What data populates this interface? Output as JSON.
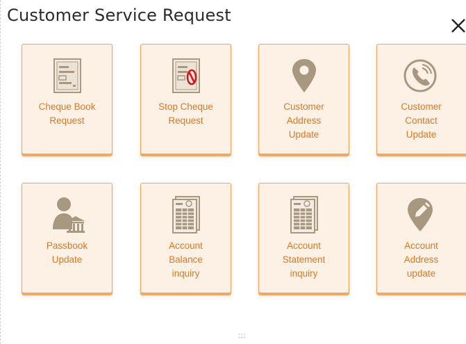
{
  "dialog": {
    "title": "Customer Service Request"
  },
  "tiles": [
    {
      "label1": "Cheque Book",
      "label2": "Request",
      "label3": "",
      "icon": "cheque-book-icon"
    },
    {
      "label1": "Stop Cheque",
      "label2": "Request",
      "label3": "",
      "icon": "stop-cheque-icon"
    },
    {
      "label1": "Customer",
      "label2": "Address",
      "label3": "Update",
      "icon": "location-pin-icon"
    },
    {
      "label1": "Customer",
      "label2": "Contact",
      "label3": "Update",
      "icon": "phone-icon"
    },
    {
      "label1": "Passbook",
      "label2": "Update",
      "label3": "",
      "icon": "passbook-icon"
    },
    {
      "label1": "Account",
      "label2": "Balance",
      "label3": "inquiry",
      "icon": "document-icon"
    },
    {
      "label1": "Account",
      "label2": "Statement",
      "label3": "inquiry",
      "icon": "document-icon"
    },
    {
      "label1": "Account",
      "label2": "Address",
      "label3": "update",
      "icon": "edit-pin-icon"
    }
  ],
  "footer": {
    "grip": ":::"
  },
  "colors": {
    "accent": "#e2761d",
    "tile_bg": "#fdf1e6",
    "icon": "#a89880"
  }
}
